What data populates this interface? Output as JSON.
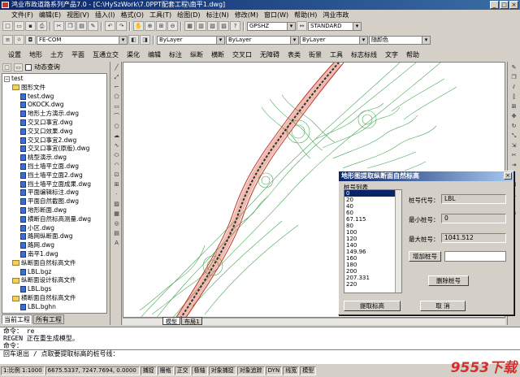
{
  "title": "鸿业市政道路系列产品7.0 - [C:\\HySzWork\\7.0PPT配套工程\\南平1.dwg]",
  "menubar": [
    "文件(F)",
    "编辑(E)",
    "视图(V)",
    "插入(I)",
    "格式(O)",
    "工具(T)",
    "绘图(D)",
    "标注(N)",
    "修改(M)",
    "窗口(W)",
    "帮助(H)",
    "鸿业市政"
  ],
  "toolbar": {
    "combo_textstyle": "GPSHZ",
    "combo_dimstyle": "STANDARD",
    "combo_layer": "FE-COM",
    "combo_color": "ByLayer",
    "combo_linetype": "ByLayer",
    "combo_lineweight": "ByLayer",
    "combo_plotstyle": "随颜色"
  },
  "cnmenu": [
    "设置",
    "地形",
    "土方",
    "平面",
    "互通立交",
    "渠化",
    "编辑",
    "标注",
    "纵断",
    "横断",
    "交叉口",
    "无障碍",
    "表类",
    "街景",
    "工具",
    "标志标线",
    "文字",
    "帮助"
  ],
  "leftpanel": {
    "checkbox_label": "动态查询",
    "tree": [
      {
        "level": 0,
        "type": "exp",
        "label": "test"
      },
      {
        "level": 1,
        "type": "folder",
        "label": "图形文件"
      },
      {
        "level": 2,
        "type": "dwg",
        "label": "test.dwg"
      },
      {
        "level": 2,
        "type": "dwg",
        "label": "OKOCK.dwg"
      },
      {
        "level": 2,
        "type": "dwg",
        "label": "地形土方演示.dwg"
      },
      {
        "level": 2,
        "type": "dwg",
        "label": "交叉口事宜.dwg"
      },
      {
        "level": 2,
        "type": "dwg",
        "label": "交叉口效果.dwg"
      },
      {
        "level": 2,
        "type": "dwg",
        "label": "交叉口事宜2.dwg"
      },
      {
        "level": 2,
        "type": "dwg",
        "label": "交叉口事宜(原版).dwg"
      },
      {
        "level": 2,
        "type": "dwg",
        "label": "桃型演示.dwg"
      },
      {
        "level": 2,
        "type": "dwg",
        "label": "挡土墙平立面.dwg"
      },
      {
        "level": 2,
        "type": "dwg",
        "label": "挡土墙平立面2.dwg"
      },
      {
        "level": 2,
        "type": "dwg",
        "label": "挡土墙平立面成果.dwg"
      },
      {
        "level": 2,
        "type": "dwg",
        "label": "平面编辑标注.dwg"
      },
      {
        "level": 2,
        "type": "dwg",
        "label": "平面自然截图.dwg"
      },
      {
        "level": 2,
        "type": "dwg",
        "label": "地形断面.dwg"
      },
      {
        "level": 2,
        "type": "dwg",
        "label": "横断自然标高测量.dwg"
      },
      {
        "level": 2,
        "type": "dwg",
        "label": "小区.dwg"
      },
      {
        "level": 2,
        "type": "dwg",
        "label": "路网纵断面.dwg"
      },
      {
        "level": 2,
        "type": "dwg",
        "label": "路网.dwg"
      },
      {
        "level": 2,
        "type": "dwg",
        "label": "南平1.dwg"
      },
      {
        "level": 1,
        "type": "folder",
        "label": "纵断面自然标高文件"
      },
      {
        "level": 2,
        "type": "dwg",
        "label": "LBL.bgz"
      },
      {
        "level": 1,
        "type": "folder",
        "label": "纵断面设计标高文件"
      },
      {
        "level": 2,
        "type": "dwg",
        "label": "LBL.bgs"
      },
      {
        "level": 1,
        "type": "folder",
        "label": "横断面自然标高文件"
      },
      {
        "level": 2,
        "type": "dwg",
        "label": "LBL.bghn"
      }
    ],
    "tabs": [
      "当前工程",
      "所有工程"
    ]
  },
  "model_tabs": [
    "模型",
    "布局1"
  ],
  "dialog": {
    "title": "地形图提取纵断面自然标高",
    "close": "×",
    "group_label": "桩号列表",
    "stations": [
      "0",
      "20",
      "40",
      "60",
      "67.115",
      "80",
      "100",
      "120",
      "140",
      "149.96",
      "160",
      "180",
      "200",
      "207.331",
      "220"
    ],
    "selected_station": "0",
    "road_code_label": "桩号代号：",
    "road_code_value": "LBL",
    "min_label": "最小桩号：",
    "min_value": "0",
    "max_label": "最大桩号：",
    "max_value": "1041.512",
    "add_button": "增加桩号",
    "add_input": "",
    "delete_button": "删除桩号",
    "extract_button": "提取标高",
    "cancel_button": "取 消"
  },
  "command_lines": [
    "命令：  re",
    "REGEN 正在重生成模型。",
    "命令：",
    "回车退出 / 点取要提取标高的桩号线："
  ],
  "status": {
    "scale": "1:比例 1:1000",
    "coords": "6675.5337,  7247.7694,  0.0000",
    "toggles": [
      "捕捉",
      "栅格",
      "正交",
      "极轴",
      "对象捕捉",
      "对象追踪",
      "DYN",
      "线宽",
      "模型"
    ]
  },
  "watermark": "9553下载"
}
